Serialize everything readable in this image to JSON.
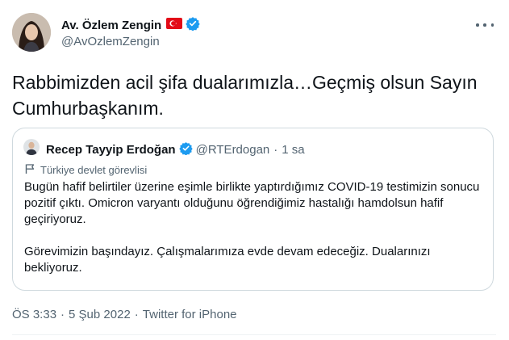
{
  "author": {
    "name": "Av. Özlem Zengin",
    "handle": "@AvOzlemZengin",
    "flag_icon": "turkey-flag-icon",
    "verified_icon": "verified-badge-icon"
  },
  "tweet": {
    "text": "Rabbimizden acil şifa dualarımızla…Geçmiş olsun Sayın Cumhurbaşkanım."
  },
  "quoted_tweet": {
    "name": "Recep Tayyip Erdoğan",
    "handle": "@RTErdogan",
    "separator": "·",
    "time": "1 sa",
    "label": "Türkiye devlet görevlisi",
    "paragraphs": [
      "Bugün hafif belirtiler üzerine eşimle birlikte yaptırdığımız COVID-19 testimizin sonucu pozitif çıktı. Omicron varyantı olduğunu öğrendiğimiz hastalığı hamdolsun hafif geçiriyoruz.",
      "Görevimizin başındayız. Çalışmalarımıza evde devam edeceğiz. Dualarınızı bekliyoruz."
    ]
  },
  "meta": {
    "time": "ÖS 3:33",
    "separator": "·",
    "date": "5 Şub 2022",
    "source": "Twitter for iPhone"
  },
  "colors": {
    "verified_blue": "#1d9bf0",
    "flag_red": "#e30a17",
    "secondary_text": "#536471",
    "border": "#cfd9de"
  }
}
